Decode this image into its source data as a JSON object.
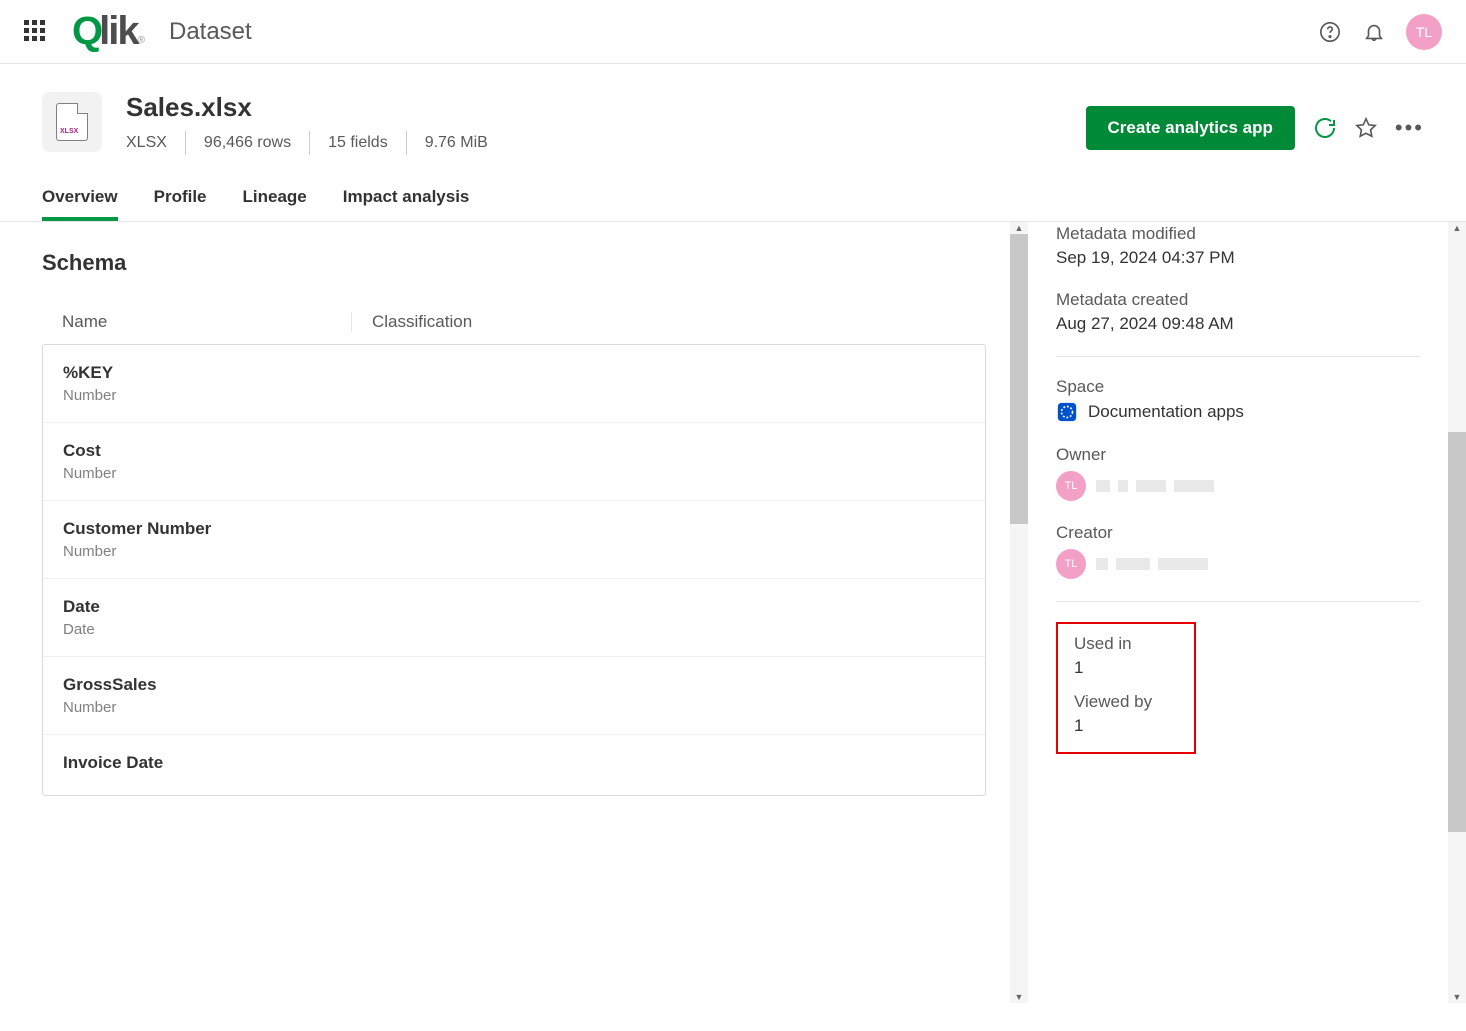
{
  "topnav": {
    "breadcrumb": "Dataset",
    "avatar": "TL"
  },
  "header": {
    "title": "Sales.xlsx",
    "file_type": "XLSX",
    "file_badge": "XLSX",
    "rows": "96,466 rows",
    "fields": "15 fields",
    "size": "9.76 MiB",
    "create_button": "Create analytics app"
  },
  "tabs": {
    "overview": "Overview",
    "profile": "Profile",
    "lineage": "Lineage",
    "impact": "Impact analysis"
  },
  "schema": {
    "heading": "Schema",
    "col_name": "Name",
    "col_class": "Classification",
    "fields": [
      {
        "name": "%KEY",
        "type": "Number"
      },
      {
        "name": "Cost",
        "type": "Number"
      },
      {
        "name": "Customer Number",
        "type": "Number"
      },
      {
        "name": "Date",
        "type": "Date"
      },
      {
        "name": "GrossSales",
        "type": "Number"
      },
      {
        "name": "Invoice Date",
        "type": ""
      }
    ]
  },
  "details": {
    "metadata_modified_label": "Metadata modified",
    "metadata_modified_value": "Sep 19, 2024 04:37 PM",
    "metadata_created_label": "Metadata created",
    "metadata_created_value": "Aug 27, 2024 09:48 AM",
    "space_label": "Space",
    "space_value": "Documentation apps",
    "owner_label": "Owner",
    "owner_avatar": "TL",
    "creator_label": "Creator",
    "creator_avatar": "TL",
    "used_in_label": "Used in",
    "used_in_value": "1",
    "viewed_by_label": "Viewed by",
    "viewed_by_value": "1"
  }
}
